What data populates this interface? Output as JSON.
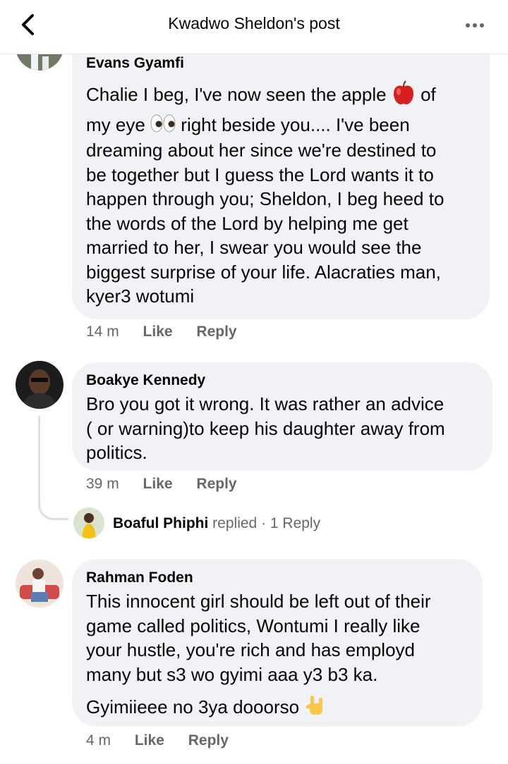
{
  "header": {
    "title": "Kwadwo Sheldon's post",
    "back_icon": "chevron-left-icon",
    "more_icon": "more-horizontal-icon"
  },
  "comments": [
    {
      "author": "Evans Gyamfi",
      "line1_a": "Chalie I beg, I've now seen the apple",
      "line1_b": "of",
      "line2_a": "my eye",
      "line2_b": "right beside you.... I've been",
      "rest": "dreaming about her since we're destined to\nbe together but I guess the Lord wants it to\nhappen through you; Sheldon, I beg heed to\nthe words of the Lord by helping me get\nmarried to her, I swear you would see the\nbiggest surprise of your life. Alacraties man,\nkyer3 wotumi",
      "emoji1": "red-apple-icon",
      "emoji2": "eyes-icon",
      "time": "14 m",
      "like": "Like",
      "reply": "Reply"
    },
    {
      "author": "Boakye Kennedy",
      "text": "Bro you got it wrong. It was rather an advice\n( or warning)to keep his daughter away from\npolitics.",
      "time": "39 m",
      "like": "Like",
      "reply": "Reply"
    },
    {
      "author": "Rahman Foden",
      "text": "This innocent girl should be left out of their\ngame called politics, Wontumi I really like\nyour hustle, you're rich and has employd\nmany but s3 wo gyimi aaa y3 b3 ka.",
      "text2": "Gyimiieee no 3ya dooorso",
      "emoji": "love-you-gesture-icon",
      "time": "4 m",
      "like": "Like",
      "reply": "Reply"
    }
  ],
  "reply_summary": {
    "name": "Boaful Phiphi",
    "action": "replied",
    "count": "· 1 Reply"
  },
  "colors": {
    "bubble": "#f0f2f5",
    "meta": "#65676b",
    "text": "#050505"
  }
}
